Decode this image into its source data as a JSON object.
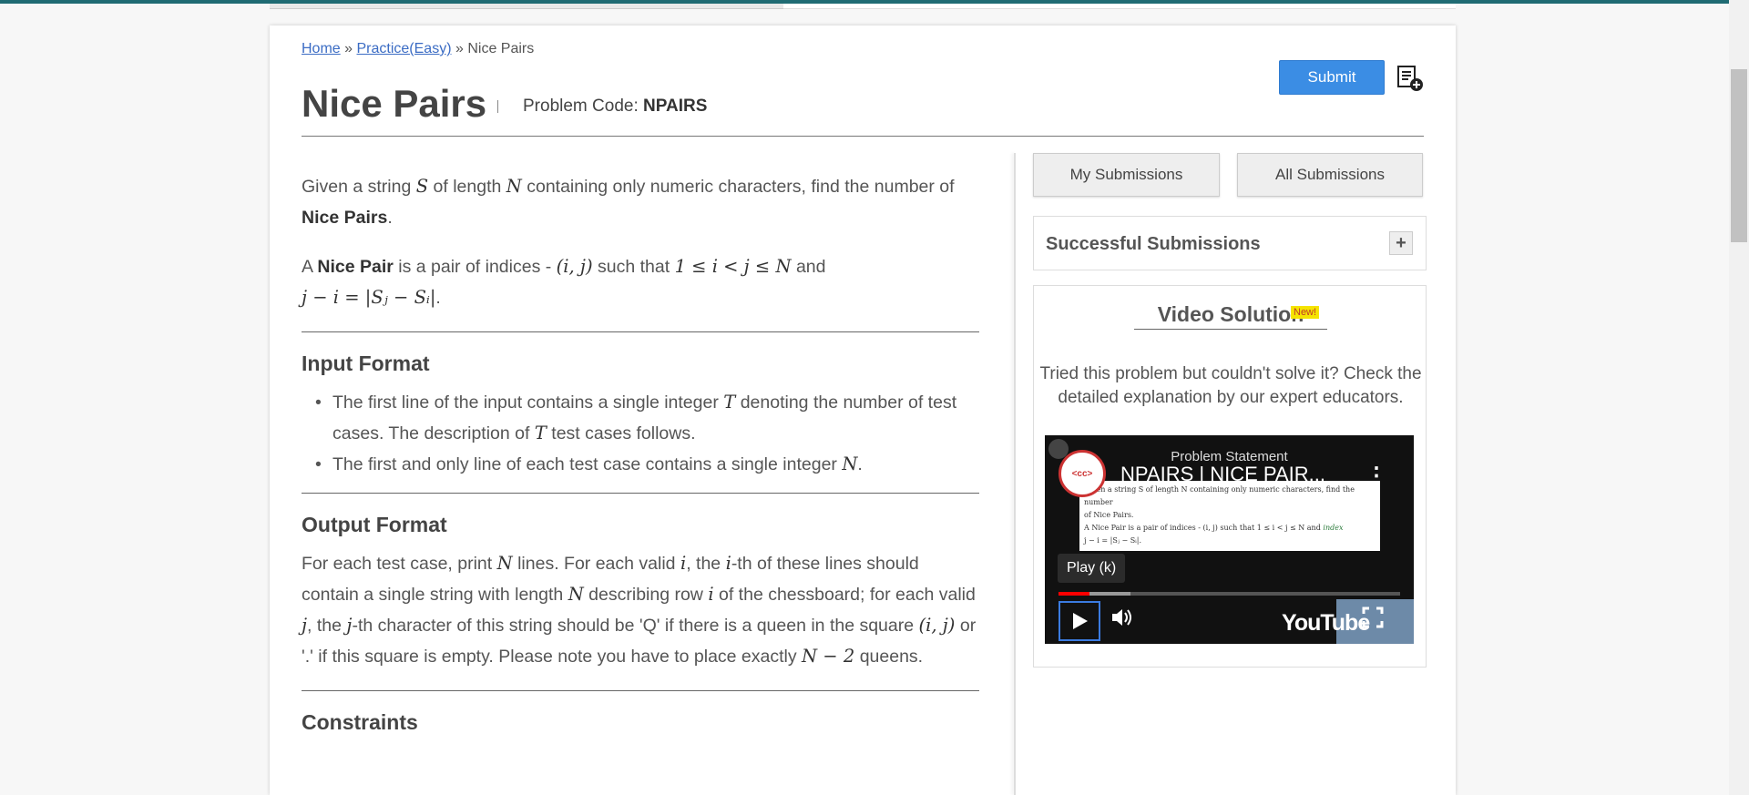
{
  "breadcrumb": {
    "home": "Home",
    "sep1": "»",
    "practice": "Practice(Easy)",
    "sep2": "»",
    "current": "Nice Pairs"
  },
  "header": {
    "title": "Nice Pairs",
    "code_label": "Problem Code:",
    "code_value": "NPAIRS",
    "submit_label": "Submit",
    "add_icon": "add-to-list-icon"
  },
  "statement": {
    "intro_1": "Given a string",
    "var_S": "S",
    "intro_2": "of length",
    "var_N": "N",
    "intro_3": "containing only numeric characters, find the number of",
    "nice_pairs": "Nice Pairs",
    "period": ".",
    "p2_a": "A",
    "nice_pair": "Nice Pair",
    "p2_b": "is a pair of indices -",
    "math_ij": "(i, j)",
    "p2_c": "such that",
    "math_cond": "1 ≤ i < j ≤ N",
    "p2_d": "and",
    "math_eq": "j − i = |Sⱼ − Sᵢ|",
    "p2_e": "."
  },
  "input_format": {
    "heading": "Input Format",
    "item1_a": "The first line of the input contains a single integer",
    "T": "T",
    "item1_b": "denoting the number of test cases. The description of",
    "item1_c": "test cases follows.",
    "item2_a": "The first and only line of each test case contains a single integer",
    "N": "N",
    "item2_b": "."
  },
  "output_format": {
    "heading": "Output Format",
    "t1": "For each test case, print",
    "N": "N",
    "t2": "lines. For each valid",
    "i": "i",
    "t3": ", the",
    "t4": "-th of these lines should contain a single string with length",
    "t5": "describing row",
    "t6": "of the chessboard; for each valid",
    "j": "j",
    "t7": ", the",
    "t8": "-th character of this string should be 'Q' if there is a queen in the square",
    "ij": "(i, j)",
    "t9": "or '.' if this square is empty. Please note you have to place exactly",
    "n_minus_2": "N − 2",
    "t10": "queens."
  },
  "constraints": {
    "heading": "Constraints"
  },
  "sidebar": {
    "my_submissions": "My Submissions",
    "all_submissions": "All Submissions",
    "successful_submissions": "Successful Submissions",
    "expand": "+",
    "video_solution": "Video Solution",
    "new_badge": "New!",
    "video_desc": "Tried this problem but couldn't solve it? Check the detailed explanation by our expert educators."
  },
  "video": {
    "top_label": "Problem Statement",
    "title": "NPAIRS | NICE PAIR...",
    "channel_label": "<cc>",
    "thumb_line1": "Given a string S of length N containing only numeric characters, find the number",
    "thumb_line2": "of Nice Pairs.",
    "thumb_line3": "A Nice Pair is a pair of indices - (i, j) such that 1 ≤ i < j ≤ N and",
    "thumb_line4": "j − i = |Sⱼ − Sᵢ|.",
    "scribble": "index",
    "tooltip": "Play (k)",
    "progress": 0.09,
    "buffered": 0.21,
    "logo": "YouTube",
    "colors": {
      "accent": "#3b8de4",
      "progress": "#ff0000"
    }
  }
}
